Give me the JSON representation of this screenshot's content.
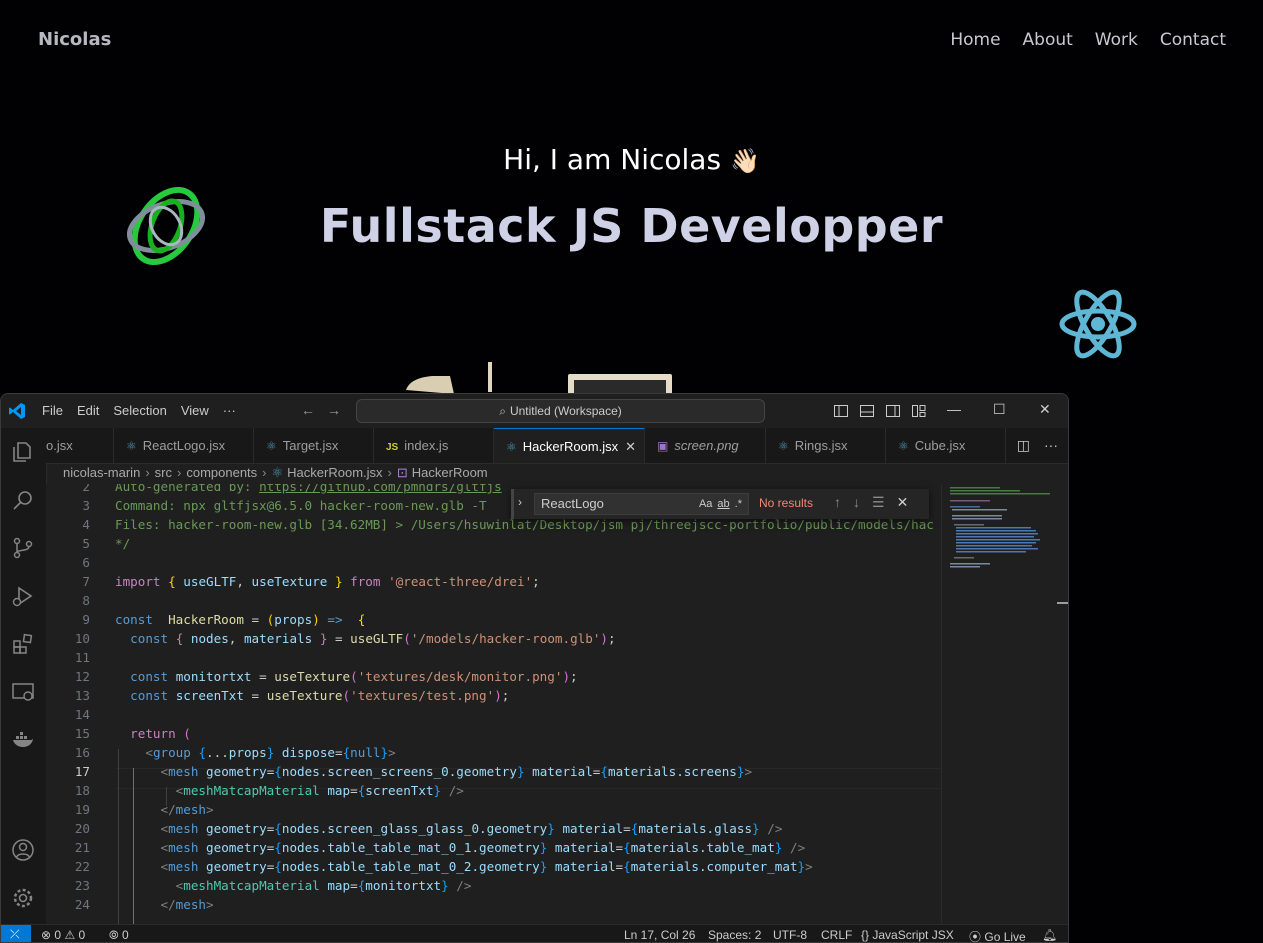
{
  "site": {
    "logo": "Nicolas",
    "nav": [
      "Home",
      "About",
      "Work",
      "Contact"
    ],
    "greeting": "Hi, I am Nicolas",
    "wave_emoji": "👋🏻",
    "title": "Fullstack JS Developper"
  },
  "vscode": {
    "menu": [
      "File",
      "Edit",
      "Selection",
      "View",
      "···"
    ],
    "command_center": "Untitled (Workspace)",
    "tabs": [
      {
        "label": "o.jsx",
        "icon": "react-icon"
      },
      {
        "label": "ReactLogo.jsx",
        "icon": "react-icon"
      },
      {
        "label": "Target.jsx",
        "icon": "react-icon"
      },
      {
        "label": "index.js",
        "icon": "js-icon"
      },
      {
        "label": "HackerRoom.jsx",
        "icon": "react-icon",
        "active": true
      },
      {
        "label": "screen.png",
        "icon": "image-icon"
      },
      {
        "label": "Rings.jsx",
        "icon": "react-icon"
      },
      {
        "label": "Cube.jsx",
        "icon": "react-icon"
      }
    ],
    "breadcrumbs": [
      "nicolas-marin",
      "src",
      "components",
      "HackerRoom.jsx",
      "HackerRoom"
    ],
    "find": {
      "query": "ReactLogo",
      "options": [
        "Aa",
        "ab",
        ".*"
      ],
      "result": "No results"
    },
    "line_numbers": [
      "2",
      "3",
      "4",
      "5",
      "6",
      "7",
      "8",
      "9",
      "10",
      "11",
      "12",
      "13",
      "14",
      "15",
      "16",
      "17",
      "18",
      "19",
      "20",
      "21",
      "22",
      "23",
      "24"
    ],
    "current_line": "17",
    "code": {
      "l2_text": "Auto-generated by: ",
      "l2_link": "https://github.com/pmndrs/gltfjs",
      "l3": "Command: npx gltfjsx@6.5.0 hacker-room-new.glb -T",
      "l4": "Files: hacker-room-new.glb [34.62MB] > /Users/hsuwinlat/Desktop/jsm pj/threejscc-portfolio/public/models/hac",
      "l5": "*/",
      "l7_from": "@react-three/drei",
      "l10_path": "/models/hacker-room.glb",
      "l12_path": "textures/desk/monitor.png",
      "l13_path": "textures/test.png"
    },
    "status": {
      "problems": "0",
      "warnings": "0",
      "ports": "0",
      "position": "Ln 17, Col 26",
      "spaces": "Spaces: 2",
      "encoding": "UTF-8",
      "eol": "CRLF",
      "language": "JavaScript JSX",
      "golive": "Go Live"
    }
  }
}
